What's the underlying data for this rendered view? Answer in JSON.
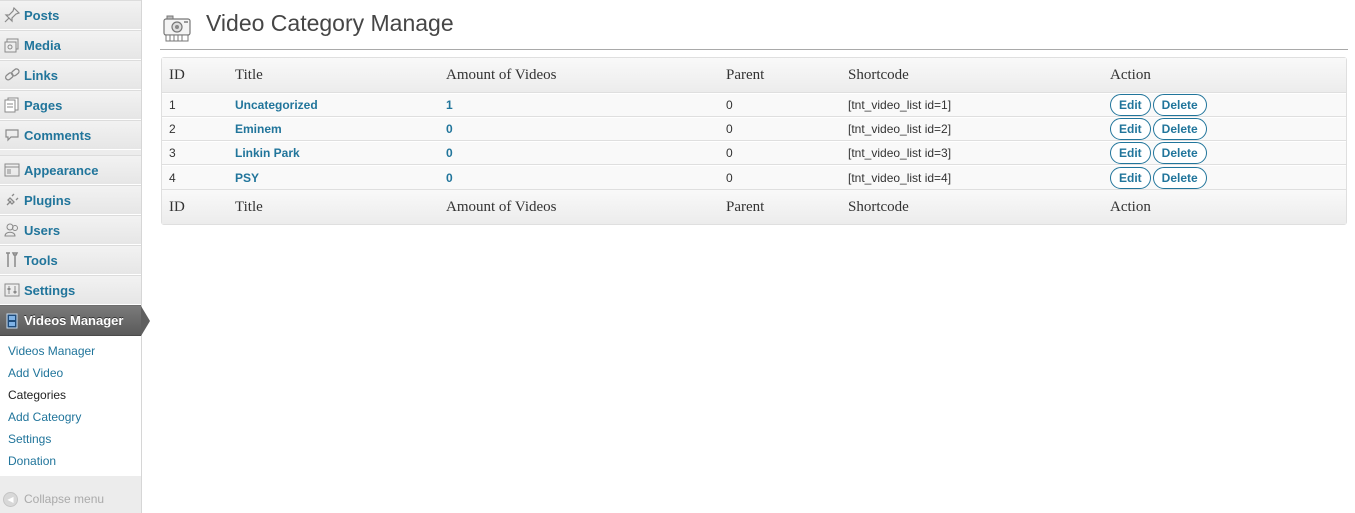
{
  "sidebar": {
    "items": [
      {
        "label": "Posts",
        "icon": "pushpin-icon"
      },
      {
        "label": "Media",
        "icon": "media-icon"
      },
      {
        "label": "Links",
        "icon": "link-icon"
      },
      {
        "label": "Pages",
        "icon": "pages-icon"
      },
      {
        "label": "Comments",
        "icon": "comments-icon"
      },
      {
        "label": "Appearance",
        "icon": "appearance-icon"
      },
      {
        "label": "Plugins",
        "icon": "plugin-icon"
      },
      {
        "label": "Users",
        "icon": "users-icon"
      },
      {
        "label": "Tools",
        "icon": "tools-icon"
      },
      {
        "label": "Settings",
        "icon": "settings-icon"
      }
    ],
    "active": {
      "label": "Videos Manager",
      "icon": "film-icon"
    },
    "submenu": [
      {
        "label": "Videos Manager"
      },
      {
        "label": "Add Video"
      },
      {
        "label": "Categories"
      },
      {
        "label": "Add Cateogry"
      },
      {
        "label": "Settings"
      },
      {
        "label": "Donation"
      }
    ],
    "current_submenu": "Categories",
    "collapse_label": "Collapse menu"
  },
  "page": {
    "title": "Video Category Manage"
  },
  "table": {
    "columns": [
      "ID",
      "Title",
      "Amount of Videos",
      "Parent",
      "Shortcode",
      "Action"
    ],
    "rows": [
      {
        "id": "1",
        "title": "Uncategorized",
        "amount": "1",
        "parent": "0",
        "shortcode": "[tnt_video_list id=1]"
      },
      {
        "id": "2",
        "title": "Eminem",
        "amount": "0",
        "parent": "0",
        "shortcode": "[tnt_video_list id=2]"
      },
      {
        "id": "3",
        "title": "Linkin Park",
        "amount": "0",
        "parent": "0",
        "shortcode": "[tnt_video_list id=3]"
      },
      {
        "id": "4",
        "title": "PSY",
        "amount": "0",
        "parent": "0",
        "shortcode": "[tnt_video_list id=4]"
      }
    ],
    "edit_label": "Edit",
    "delete_label": "Delete"
  },
  "colors": {
    "link": "#21759b",
    "active_menu": "#5f5f5f"
  }
}
